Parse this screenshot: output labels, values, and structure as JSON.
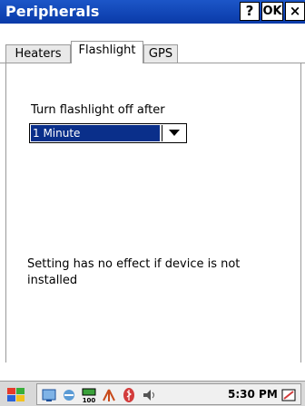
{
  "window": {
    "title": "Peripherals",
    "help_label": "?",
    "ok_label": "OK",
    "close_label": "×"
  },
  "tabs": [
    {
      "label": "Heaters",
      "active": false
    },
    {
      "label": "Flashlight",
      "active": true
    },
    {
      "label": "GPS",
      "active": false
    }
  ],
  "flashlight": {
    "prompt": "Turn flashlight off after",
    "selected_value": "1 Minute",
    "note_line1": "Setting has no effect if device is not",
    "note_line2": "installed"
  },
  "taskbar": {
    "clock": "5:30 PM",
    "tray_badge": "100"
  },
  "colors": {
    "titlebar": "#1c56c8",
    "selection": "#0a2f8a",
    "taskbar": "#d8d8d8"
  }
}
